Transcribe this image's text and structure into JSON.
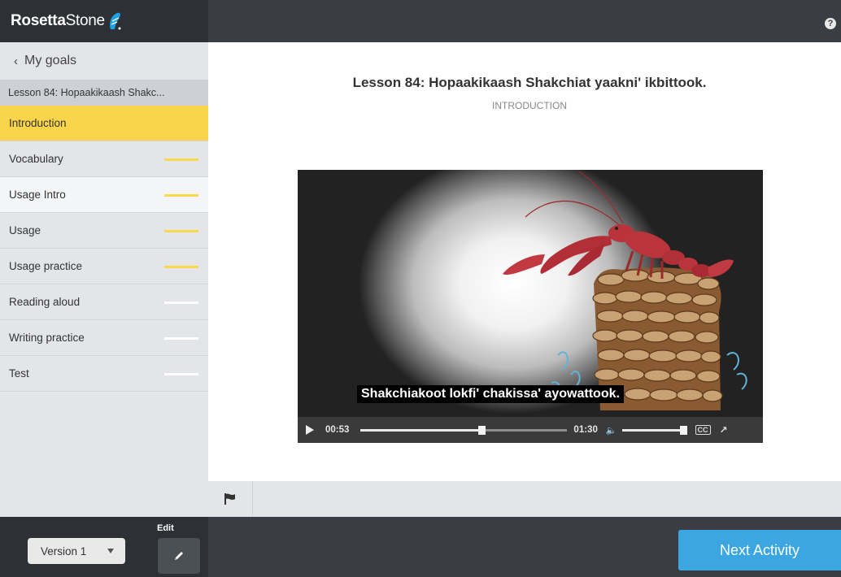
{
  "header": {
    "brand_bold": "Rosetta",
    "brand_light": "Stone",
    "help_label": "?"
  },
  "sidebar": {
    "back_label": "My goals",
    "lesson_label": "Lesson 84: Hopaakikaash Shakc...",
    "items": [
      {
        "label": "Introduction",
        "state": "active",
        "progress": null
      },
      {
        "label": "Vocabulary",
        "state": "normal",
        "progress": 1
      },
      {
        "label": "Usage Intro",
        "state": "current",
        "progress": 1
      },
      {
        "label": "Usage",
        "state": "normal",
        "progress": 1
      },
      {
        "label": "Usage practice",
        "state": "normal",
        "progress": 1
      },
      {
        "label": "Reading aloud",
        "state": "normal",
        "progress": 0
      },
      {
        "label": "Writing practice",
        "state": "normal",
        "progress": 0
      },
      {
        "label": "Test",
        "state": "normal",
        "progress": 0
      }
    ]
  },
  "main": {
    "title": "Lesson 84: Hopaakikaash Shakchiat yaakni' ikbittook.",
    "subtitle": "INTRODUCTION"
  },
  "video": {
    "caption": "Shakchiakoot lokfi' chakissa' ayowattook.",
    "current_time": "00:53",
    "duration": "01:30",
    "playback_fraction": 0.59,
    "volume_fraction": 0.95
  },
  "footer": {
    "version_label": "Version 1",
    "edit_label": "Edit",
    "next_label": "Next Activity"
  },
  "colors": {
    "accent_yellow": "#fad44a",
    "next_blue": "#3ca6e0",
    "dark_bar": "#3a3e44"
  }
}
